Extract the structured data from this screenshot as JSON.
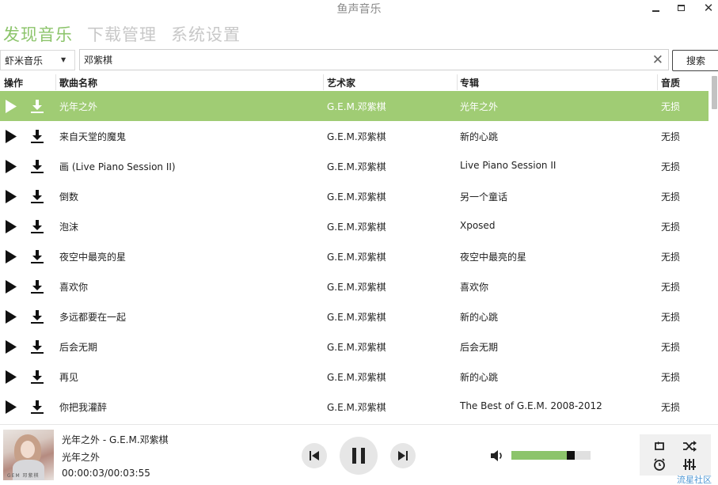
{
  "window": {
    "title": "鱼声音乐"
  },
  "nav": {
    "tabs": [
      "发现音乐",
      "下载管理",
      "系统设置"
    ]
  },
  "search": {
    "source": "虾米音乐",
    "query": "邓紫棋",
    "button_label": "搜索"
  },
  "table": {
    "headers": {
      "action": "操作",
      "name": "歌曲名称",
      "artist": "艺术家",
      "album": "专辑",
      "quality": "音质"
    },
    "rows": [
      {
        "name": "光年之外",
        "artist": "G.E.M.邓紫棋",
        "album": "光年之外",
        "quality": "无损"
      },
      {
        "name": "来自天堂的魔鬼",
        "artist": "G.E.M.邓紫棋",
        "album": "新的心跳",
        "quality": "无损"
      },
      {
        "name": "画 (Live Piano Session II)",
        "artist": "G.E.M.邓紫棋",
        "album": "Live Piano Session II",
        "quality": "无损"
      },
      {
        "name": "倒数",
        "artist": "G.E.M.邓紫棋",
        "album": "另一个童话",
        "quality": "无损"
      },
      {
        "name": "泡沫",
        "artist": "G.E.M.邓紫棋",
        "album": "Xposed",
        "quality": "无损"
      },
      {
        "name": "夜空中最亮的星",
        "artist": "G.E.M.邓紫棋",
        "album": "夜空中最亮的星",
        "quality": "无损"
      },
      {
        "name": "喜欢你",
        "artist": "G.E.M.邓紫棋",
        "album": "喜欢你",
        "quality": "无损"
      },
      {
        "name": "多远都要在一起",
        "artist": "G.E.M.邓紫棋",
        "album": "新的心跳",
        "quality": "无损"
      },
      {
        "name": "后会无期",
        "artist": "G.E.M.邓紫棋",
        "album": "后会无期",
        "quality": "无损"
      },
      {
        "name": "再见",
        "artist": "G.E.M.邓紫棋",
        "album": "新的心跳",
        "quality": "无损"
      },
      {
        "name": "你把我灌醉",
        "artist": "G.E.M.邓紫棋",
        "album": "The Best of G.E.M. 2008-2012",
        "quality": "无损"
      }
    ],
    "selected_index": 0
  },
  "player": {
    "now_playing": "光年之外 - G.E.M.邓紫棋",
    "album": "光年之外",
    "time": "00:00:03/00:03:55",
    "cover_text": "GEM 邓紫棋",
    "volume": 0.8
  },
  "icons": {
    "play": "play-icon",
    "download": "download-icon",
    "prev": "skip-previous-icon",
    "pause": "pause-icon",
    "next": "skip-next-icon",
    "volume": "volume-icon",
    "loop": "repeat-icon",
    "shuffle": "shuffle-icon",
    "alarm": "alarm-icon",
    "equalizer": "equalizer-icon"
  },
  "colors": {
    "accent": "#8cc46b",
    "selected_row": "#a0cc74",
    "inactive_tab": "#c8c8c8"
  },
  "watermark": "流星社区"
}
